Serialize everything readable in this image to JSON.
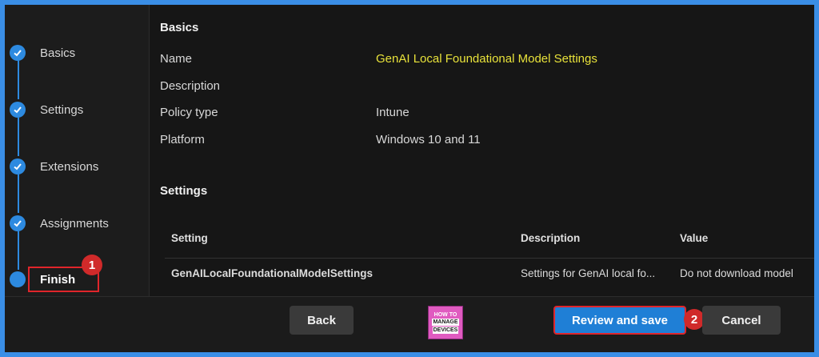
{
  "wizard": {
    "steps": [
      {
        "label": "Basics"
      },
      {
        "label": "Settings"
      },
      {
        "label": "Extensions"
      },
      {
        "label": "Assignments"
      },
      {
        "label": "Finish"
      }
    ],
    "current_step": "Finish"
  },
  "basics": {
    "title": "Basics",
    "name_key": "Name",
    "name_value": "GenAI Local Foundational Model Settings",
    "description_key": "Description",
    "description_value": "",
    "policy_type_key": "Policy type",
    "policy_type_value": "Intune",
    "platform_key": "Platform",
    "platform_value": "Windows 10 and 11"
  },
  "settings": {
    "title": "Settings",
    "columns": [
      "Setting",
      "Description",
      "Value"
    ],
    "rows": [
      {
        "setting": "GenAILocalFoundationalModelSettings",
        "description": "Settings for GenAI local fo...",
        "value": "Do not download model"
      }
    ]
  },
  "footer": {
    "back_label": "Back",
    "review_label": "Review and save",
    "cancel_label": "Cancel",
    "logo_lines": [
      "HOW TO",
      "MANAGE",
      "DEVICES"
    ]
  },
  "annotations": {
    "badge1": "1",
    "badge2": "2"
  },
  "colors": {
    "accent": "#2d8ae0",
    "highlight": "#e0252b",
    "name_value": "#e8e23a"
  }
}
